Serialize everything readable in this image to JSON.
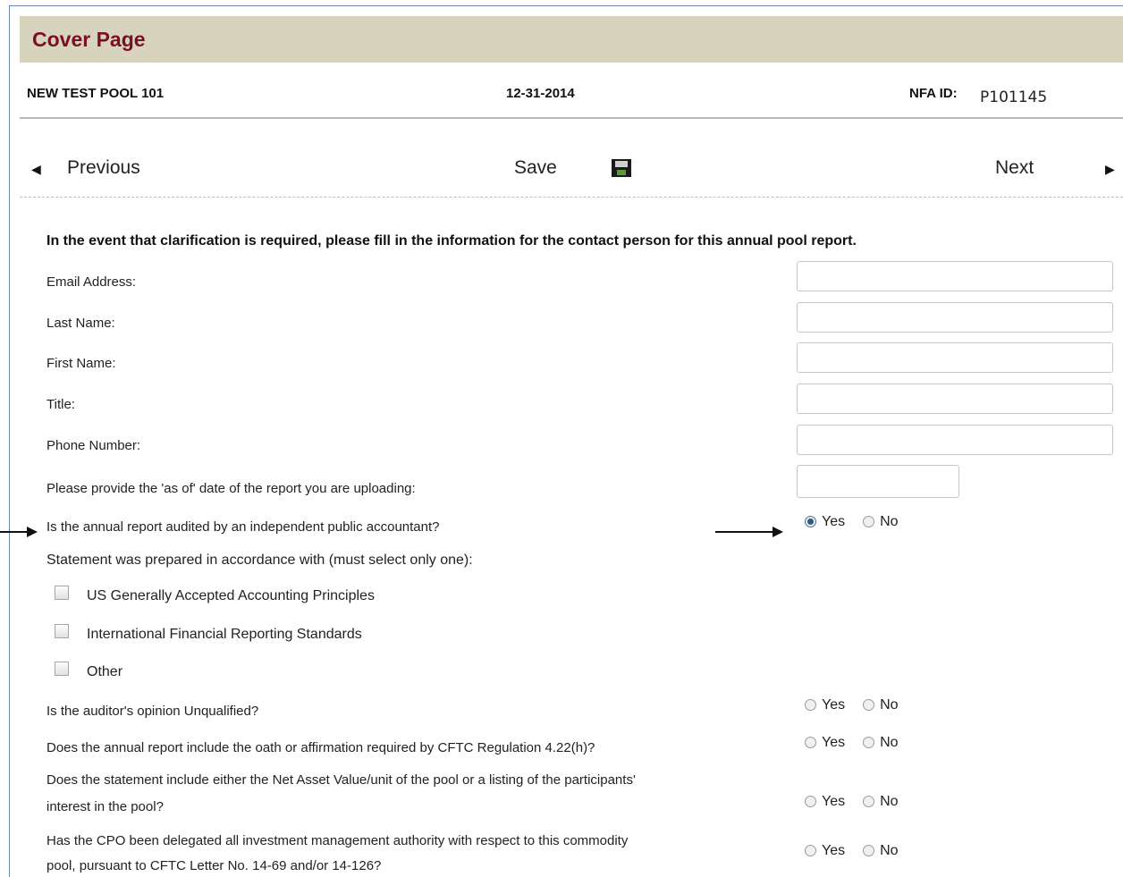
{
  "header": {
    "title": "Cover Page"
  },
  "info": {
    "pool_name": "NEW TEST POOL 101",
    "date": "12-31-2014",
    "nfa_label": "NFA ID:",
    "nfa_value": "P101145"
  },
  "nav": {
    "previous": "Previous",
    "save": "Save",
    "next": "Next"
  },
  "form": {
    "intro": "In the event that clarification is required, please fill in the information for the contact person for this annual pool report.",
    "fields": [
      {
        "label": "Email Address:",
        "value": ""
      },
      {
        "label": "Last Name:",
        "value": ""
      },
      {
        "label": "First Name:",
        "value": ""
      },
      {
        "label": "Title:",
        "value": ""
      },
      {
        "label": "Phone Number:",
        "value": ""
      }
    ],
    "as_of_date": {
      "label": "Please provide the 'as of' date of the report you are uploading:",
      "value": ""
    },
    "radio_yes": "Yes",
    "radio_no": "No",
    "q_audited": {
      "label": "Is the annual report audited by an independent public accountant?",
      "selected": "Yes"
    },
    "statement_label": "Statement was prepared in accordance with (must select only one):",
    "checkboxes": [
      {
        "label": "US Generally Accepted Accounting Principles",
        "checked": false
      },
      {
        "label": "International Financial Reporting Standards",
        "checked": false
      },
      {
        "label": "Other",
        "checked": false
      }
    ],
    "q_opinion": {
      "label": "Is the auditor's opinion Unqualified?",
      "selected": ""
    },
    "q_oath": {
      "label": "Does the annual report include the oath or affirmation required by CFTC Regulation 4.22(h)?",
      "selected": ""
    },
    "q_nav": {
      "line1": "Does the statement include either the Net Asset Value/unit of the pool or a listing of the participants'",
      "line2": "interest in the pool?",
      "selected": ""
    },
    "q_cpo": {
      "line1": "Has the CPO been delegated all investment management authority with respect to this commodity",
      "line2": "pool, pursuant to CFTC Letter No. 14-69 and/or 14-126?",
      "selected": ""
    }
  },
  "colors": {
    "title_bar": "#d8d3bd",
    "title_text": "#7a1024",
    "radio_selected": "#2a5b86"
  }
}
